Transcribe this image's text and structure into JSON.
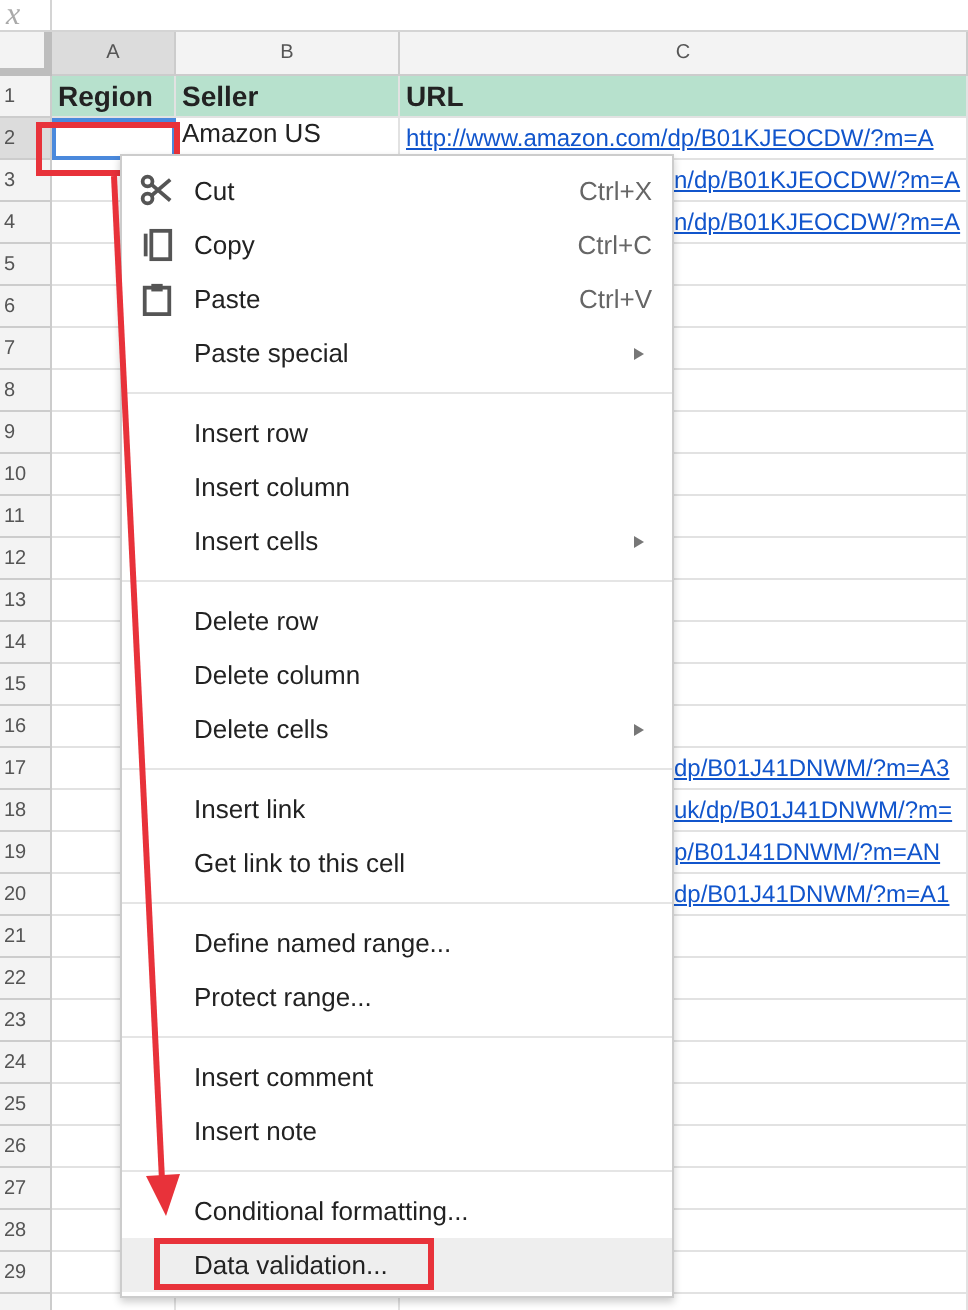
{
  "formula_bar": {
    "label": "x"
  },
  "columns": [
    {
      "label": "A",
      "selected": true
    },
    {
      "label": "B",
      "selected": false
    },
    {
      "label": "C",
      "selected": false
    }
  ],
  "rows": [
    {
      "number": "1",
      "kind": "header",
      "selected": false,
      "a": "Region",
      "b": "Seller",
      "c": "URL"
    },
    {
      "number": "2",
      "kind": "data",
      "selected": true,
      "active_cell": true,
      "b": "Amazon US",
      "c": "http://www.amazon.com/dp/B01KJEOCDW/?m=A"
    },
    {
      "number": "3",
      "kind": "data",
      "selected": false,
      "c": "n/dp/B01KJEOCDW/?m=A"
    },
    {
      "number": "4",
      "kind": "data",
      "selected": false,
      "c": "n/dp/B01KJEOCDW/?m=A"
    },
    {
      "number": "5",
      "kind": "data",
      "selected": false
    },
    {
      "number": "6",
      "kind": "data",
      "selected": false
    },
    {
      "number": "7",
      "kind": "data",
      "selected": false
    },
    {
      "number": "8",
      "kind": "data",
      "selected": false
    },
    {
      "number": "9",
      "kind": "data",
      "selected": false
    },
    {
      "number": "10",
      "kind": "data",
      "selected": false
    },
    {
      "number": "11",
      "kind": "data",
      "selected": false
    },
    {
      "number": "12",
      "kind": "data",
      "selected": false
    },
    {
      "number": "13",
      "kind": "data",
      "selected": false
    },
    {
      "number": "14",
      "kind": "data",
      "selected": false
    },
    {
      "number": "15",
      "kind": "data",
      "selected": false
    },
    {
      "number": "16",
      "kind": "data",
      "selected": false
    },
    {
      "number": "17",
      "kind": "data",
      "selected": false,
      "c": "dp/B01J41DNWM/?m=A3"
    },
    {
      "number": "18",
      "kind": "data",
      "selected": false,
      "c": "uk/dp/B01J41DNWM/?m="
    },
    {
      "number": "19",
      "kind": "data",
      "selected": false,
      "c": "p/B01J41DNWM/?m=AN"
    },
    {
      "number": "20",
      "kind": "data",
      "selected": false,
      "c": "dp/B01J41DNWM/?m=A1"
    },
    {
      "number": "21",
      "kind": "data",
      "selected": false
    },
    {
      "number": "22",
      "kind": "data",
      "selected": false
    },
    {
      "number": "23",
      "kind": "data",
      "selected": false
    },
    {
      "number": "24",
      "kind": "data",
      "selected": false
    },
    {
      "number": "25",
      "kind": "data",
      "selected": false
    },
    {
      "number": "26",
      "kind": "data",
      "selected": false
    },
    {
      "number": "27",
      "kind": "data",
      "selected": false
    },
    {
      "number": "28",
      "kind": "data",
      "selected": false
    },
    {
      "number": "29",
      "kind": "data",
      "selected": false
    }
  ],
  "context_menu": {
    "sections": [
      [
        {
          "label": "Cut",
          "shortcut": "Ctrl+X",
          "submenu": false,
          "selected": false
        },
        {
          "label": "Copy",
          "shortcut": "Ctrl+C",
          "submenu": false,
          "selected": false
        },
        {
          "label": "Paste",
          "shortcut": "Ctrl+V",
          "submenu": false,
          "selected": false
        },
        {
          "label": "Paste special",
          "submenu": true,
          "selected": false
        }
      ],
      [
        {
          "label": "Insert row",
          "submenu": false,
          "selected": false
        },
        {
          "label": "Insert column",
          "submenu": false,
          "selected": false
        },
        {
          "label": "Insert cells",
          "submenu": true,
          "selected": false
        }
      ],
      [
        {
          "label": "Delete row",
          "submenu": false,
          "selected": false
        },
        {
          "label": "Delete column",
          "submenu": false,
          "selected": false
        },
        {
          "label": "Delete cells",
          "submenu": true,
          "selected": false
        }
      ],
      [
        {
          "label": "Insert link",
          "submenu": false,
          "selected": false
        },
        {
          "label": "Get link to this cell",
          "submenu": false,
          "selected": false
        }
      ],
      [
        {
          "label": "Define named range...",
          "submenu": false,
          "selected": false
        },
        {
          "label": "Protect range...",
          "submenu": false,
          "selected": false
        }
      ],
      [
        {
          "label": "Insert comment",
          "submenu": false,
          "selected": false
        },
        {
          "label": "Insert note",
          "submenu": false,
          "selected": false
        }
      ],
      [
        {
          "label": "Conditional formatting...",
          "submenu": false,
          "selected": false
        },
        {
          "label": "Data validation...",
          "submenu": false,
          "selected": true,
          "annotated": true
        }
      ]
    ]
  },
  "annotation_arrow": true
}
